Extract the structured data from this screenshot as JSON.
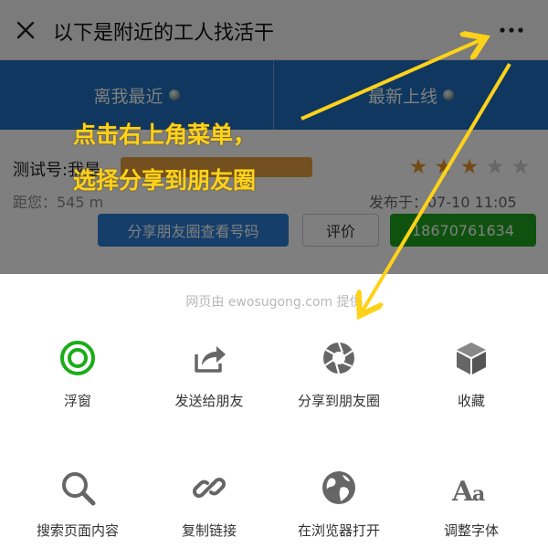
{
  "nav": {
    "close_icon": "close-icon",
    "title": "以下是附近的工人找活干",
    "more_icon": "more-dots-icon"
  },
  "tabs": [
    {
      "label": "离我最近"
    },
    {
      "label": "最新上线"
    }
  ],
  "card": {
    "name": "测试号:我是",
    "distance": "距您：545 m",
    "published": "发布于：07-10 11:05",
    "rating": 3,
    "rating_max": 5,
    "star_color": "#e8962c",
    "star_empty_color": "#cfcfcf",
    "share_button": "分享朋友圈查看号码",
    "rate_button": "评价",
    "phone_button": "18670761634"
  },
  "sheet": {
    "provider": "网页由 ewosugong.com 提供",
    "row1": [
      {
        "label": "浮窗",
        "icon": "floating-window-icon"
      },
      {
        "label": "发送给朋友",
        "icon": "share-arrow-icon"
      },
      {
        "label": "分享到朋友圈",
        "icon": "moments-shutter-icon"
      },
      {
        "label": "收藏",
        "icon": "favorite-cube-icon"
      }
    ],
    "row2": [
      {
        "label": "搜索页面内容",
        "icon": "search-icon"
      },
      {
        "label": "复制链接",
        "icon": "link-icon"
      },
      {
        "label": "在浏览器打开",
        "icon": "globe-icon"
      },
      {
        "label": "调整字体",
        "icon": "font-size-icon"
      }
    ]
  },
  "annotation": {
    "line1": "点击右上角菜单，",
    "line2": "选择分享到朋友圈",
    "color": "#ffd21a"
  },
  "colors": {
    "tab_bar": "#1e6fbf",
    "share_button": "#2a7fd4",
    "phone_button": "#1fa51f",
    "float_icon": "#1aad19",
    "icon_gray": "#666666"
  }
}
